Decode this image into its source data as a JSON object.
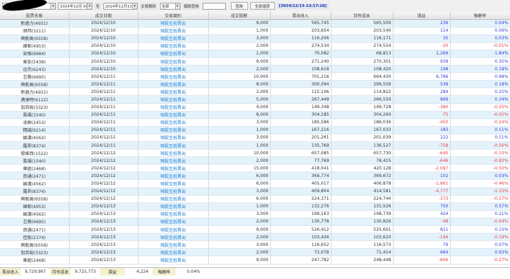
{
  "toolbar": {
    "start_date": "2024年12月 9日",
    "to_label": "至",
    "end_date": "2024年12月13日",
    "type_label": "交易類別",
    "type_value": "全部",
    "stock_query_label": "個股查詢",
    "stock_query_value": "",
    "query_button": "查詢",
    "reset_button": "全部還原",
    "timestamp": "[2024/12/13-13:17:18]"
  },
  "columns": [
    "股票名稱",
    "成交日期",
    "交易類別",
    "成交股數",
    "賣出收入",
    "持有成本",
    "損益",
    "報酬率"
  ],
  "rows": [
    [
      "新盛力(4931)",
      "2024/12/10",
      "現股互抵賣出",
      "9,000",
      "565,745",
      "565,509",
      "236",
      "0.04%"
    ],
    [
      "頎邦(3211)",
      "2024/12/10",
      "現股互抵賣出",
      "1,000",
      "203,654",
      "203,540",
      "114",
      "0.06%"
    ],
    [
      "興能高(6558)",
      "2024/12/10",
      "現股互抵賣出",
      "3,000",
      "116,206",
      "116,171",
      "35",
      "0.03%"
    ],
    [
      "緯軟(4953)",
      "2024/12/10",
      "現股互抵賣出",
      "2,000",
      "274,534",
      "274,554",
      "-20",
      "-0.01%"
    ],
    [
      "安格(6684)",
      "2024/12/10",
      "現股互抵賣出",
      "1,000",
      "70,082",
      "68,813",
      "1,269",
      "1.84%"
    ],
    [
      "東友(5438)",
      "2024/12/10",
      "現股互抵賣出",
      "9,000",
      "271,240",
      "270,301",
      "939",
      "0.35%"
    ],
    [
      "迅杰(6243)",
      "2024/12/10",
      "現股互抵賣出",
      "2,000",
      "108,618",
      "108,420",
      "198",
      "0.18%"
    ],
    [
      "芯鼎(6695)",
      "2024/12/11",
      "現股互抵賣出",
      "10,000",
      "701,216",
      "694,430",
      "6,786",
      "0.98%"
    ],
    [
      "興能高(6558)",
      "2024/12/11",
      "現股互抵賣出",
      "8,000",
      "300,094",
      "299,556",
      "538",
      "0.18%"
    ],
    [
      "新盛力(4931)",
      "2024/12/11",
      "現股互抵賣出",
      "2,000",
      "115,106",
      "114,822",
      "284",
      "0.25%"
    ],
    [
      "邁達特(6112)",
      "2024/12/11",
      "現股互抵賣出",
      "5,000",
      "267,449",
      "266,550",
      "899",
      "0.34%"
    ],
    [
      "加百裕(3323)",
      "2024/12/11",
      "現股互抵賣出",
      "4,000",
      "149,348",
      "149,728",
      "-380",
      "-0.25%"
    ],
    [
      "喬福(1540)",
      "2024/12/11",
      "現股互抵賣出",
      "8,000",
      "304,185",
      "304,260",
      "-75",
      "-0.02%"
    ],
    [
      "凌群(2453)",
      "2024/12/11",
      "現股互抵賣出",
      "3,000",
      "185,586",
      "186,036",
      "-450",
      "-0.24%"
    ],
    [
      "精誠(6214)",
      "2024/12/11",
      "現股互抵賣出",
      "1,000",
      "167,216",
      "167,033",
      "183",
      "0.11%"
    ],
    [
      "穎漢(4562)",
      "2024/12/11",
      "現股互抵賣出",
      "3,000",
      "201,261",
      "201,039",
      "222",
      "0.11%"
    ],
    [
      "羅昇(8374)",
      "2024/12/11",
      "現股互抵賣出",
      "1,000",
      "135,769",
      "136,527",
      "-758",
      "-0.56%"
    ],
    [
      "堤維西(1522)",
      "2024/12/12",
      "現股互抵賣出",
      "10,000",
      "657,085",
      "657,730",
      "-645",
      "-0.10%"
    ],
    [
      "喬福(1540)",
      "2024/12/12",
      "現股互抵賣出",
      "2,000",
      "77,769",
      "78,415",
      "-646",
      "-0.82%"
    ],
    [
      "華經(2468)",
      "2024/12/12",
      "現股互抵賣出",
      "15,000",
      "418,041",
      "420,128",
      "-2,087",
      "-0.50%"
    ],
    [
      "資通(2471)",
      "2024/12/12",
      "現股互抵賣出",
      "6,000",
      "369,774",
      "369,672",
      "102",
      "0.03%"
    ],
    [
      "穎漢(4562)",
      "2024/12/12",
      "現股互抵賣出",
      "6,000",
      "405,017",
      "406,878",
      "-1,861",
      "-0.46%"
    ],
    [
      "羅昇(8374)",
      "2024/12/12",
      "現股互抵賣出",
      "3,000",
      "409,804",
      "414,581",
      "-4,777",
      "-1.15%"
    ],
    [
      "興能高(6558)",
      "2024/12/12",
      "現股互抵賣出",
      "6,000",
      "224,371",
      "224,744",
      "-373",
      "-0.17%"
    ],
    [
      "緯軟(4953)",
      "2024/12/13",
      "現股互抵賣出",
      "1,000",
      "132,276",
      "131,526",
      "750",
      "0.57%"
    ],
    [
      "穎漢(4562)",
      "2024/12/13",
      "現股互抵賣出",
      "3,000",
      "199,163",
      "198,739",
      "424",
      "0.21%"
    ],
    [
      "芯鼎(6695)",
      "2024/12/13",
      "現股互抵賣出",
      "2,000",
      "130,778",
      "130,826",
      "-48",
      "-0.04%"
    ],
    [
      "資通(2471)",
      "2024/12/13",
      "現股互抵賣出",
      "9,000",
      "526,412",
      "525,601",
      "811",
      "0.15%"
    ],
    [
      "佳能(2374)",
      "2024/12/13",
      "現股互抵賣出",
      "2,000",
      "103,426",
      "103,620",
      "-194",
      "-0.19%"
    ],
    [
      "興能高(6558)",
      "2024/12/13",
      "現股互抵賣出",
      "3,000",
      "116,652",
      "116,573",
      "79",
      "0.07%"
    ],
    [
      "加百裕(3323)",
      "2024/12/13",
      "現股互抵賣出",
      "2,000",
      "72,078",
      "71,414",
      "664",
      "0.93%"
    ],
    [
      "華經(2468)",
      "2024/12/13",
      "現股互抵賣出",
      "9,000",
      "247,782",
      "248,448",
      "-666",
      "-0.27%"
    ]
  ],
  "footer": {
    "income_label": "賣出收入",
    "income": "9,729,997",
    "cost_label": "持有成本",
    "cost": "9,725,773",
    "pnl_label": "損益",
    "pnl": "4,224",
    "rate_label": "報酬率",
    "rate": "0.04%"
  },
  "colors": {
    "positive": "#3a3ad8",
    "negative": "#e8404a",
    "link": "#2a86d8",
    "row_alt": "#e3f2fb"
  }
}
